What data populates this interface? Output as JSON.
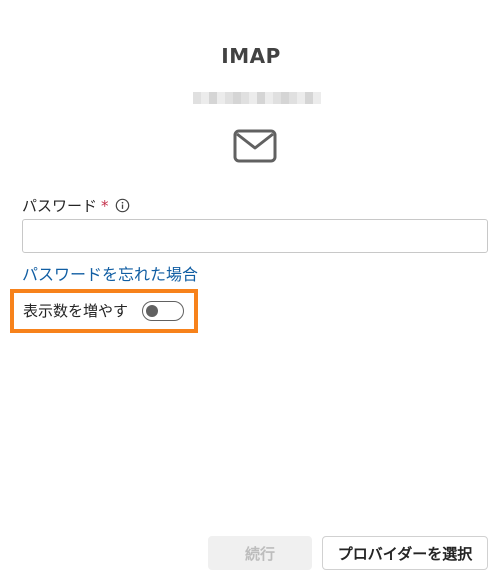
{
  "header": {
    "title": "IMAP"
  },
  "icons": {
    "mail": "mail-icon",
    "info": "info-icon"
  },
  "password": {
    "label": "パスワード",
    "required_marker": "*",
    "value": "",
    "placeholder": ""
  },
  "links": {
    "forgot_password": "パスワードを忘れた場合"
  },
  "toggle": {
    "label": "表示数を増やす",
    "state": "off"
  },
  "footer": {
    "continue_label": "続行",
    "choose_provider_label": "プロバイダーを選択"
  },
  "colors": {
    "link": "#115ea3",
    "highlight": "#f7821b",
    "required": "#c4314b",
    "disabled_text": "#bdbdbd"
  }
}
